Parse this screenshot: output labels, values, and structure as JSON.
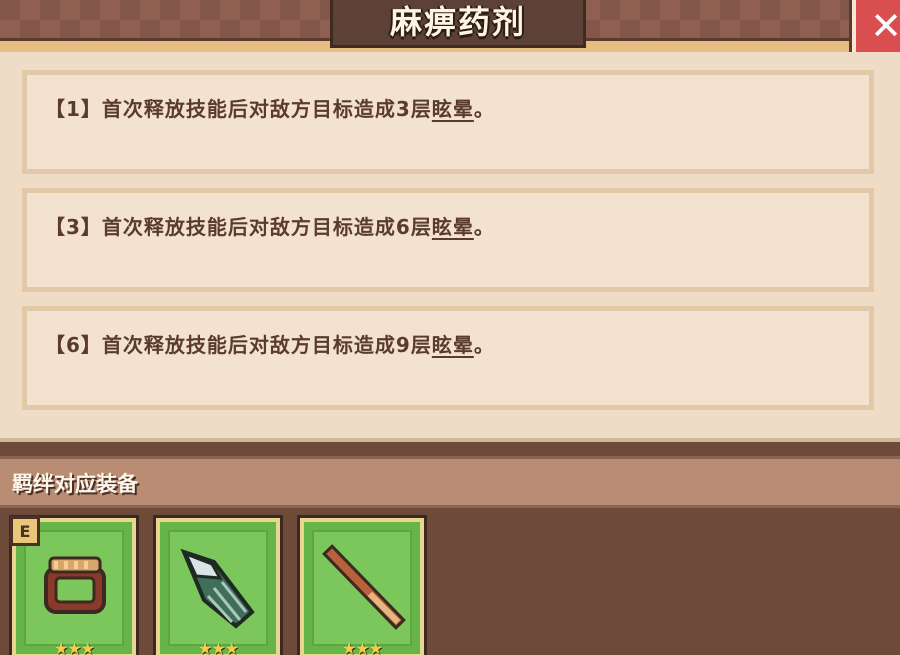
{
  "header": {
    "title": "麻痹药剂",
    "close_icon": "close-x-icon"
  },
  "effects": [
    {
      "prefix": "【1】首次释放技能后对敌方目标造成3层",
      "keyword": "眩晕",
      "suffix": "。"
    },
    {
      "prefix": "【3】首次释放技能后对敌方目标造成6层",
      "keyword": "眩晕",
      "suffix": "。"
    },
    {
      "prefix": "【6】首次释放技能后对敌方目标造成9层",
      "keyword": "眩晕",
      "suffix": "。"
    }
  ],
  "bond": {
    "title": "羁绊对应装备",
    "items": [
      {
        "icon": "ring-bracelet-icon",
        "badge": "E",
        "stars": "★★★",
        "rating": 3
      },
      {
        "icon": "green-shell-icon",
        "badge": "",
        "stars": "★★★",
        "rating": 3
      },
      {
        "icon": "wooden-stick-icon",
        "badge": "",
        "stars": "★★★",
        "rating": 3
      }
    ]
  },
  "colors": {
    "panel": "#efdcc6",
    "card_border": "#e3c8a8",
    "text": "#5a3b2e",
    "close": "#d94f4f",
    "equip_green": "#66b54a"
  }
}
